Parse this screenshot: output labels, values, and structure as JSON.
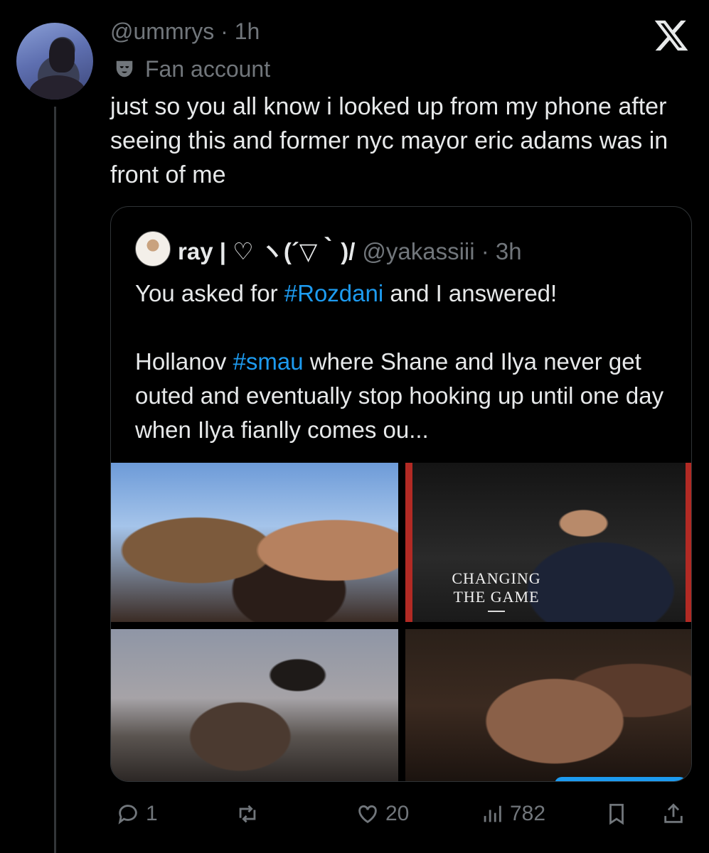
{
  "post": {
    "handle_time": "@ummrys · 1h",
    "label": "Fan account",
    "text": "just so you all know i looked up from my phone after seeing this and former nyc mayor eric adams was in front of me"
  },
  "quote": {
    "name": "ray | ♡ ヽ(´▽｀)/",
    "handle_time": "@yakassiii · 3h",
    "line1_pre": "You asked for ",
    "line1_tag": "#Rozdani",
    "line1_post": " and I answered!",
    "para_pre": "Hollanov ",
    "para_tag": "#smau",
    "para_post": " where Shane and Ilya never get outed and eventually stop hooking up until one day when Ilya fianlly comes ou...",
    "media": {
      "cover_text": "CHANGING THE GAME"
    }
  },
  "actions": {
    "replies": "1",
    "likes": "20",
    "views": "782"
  },
  "colors": {
    "background": "#000000",
    "text": "#e7e9ea",
    "muted": "#71767b",
    "link": "#1d9bf0",
    "border": "#2f3336"
  },
  "icons": [
    "x-logo-icon",
    "mask-icon",
    "reply-icon",
    "repost-icon",
    "like-icon",
    "views-icon",
    "bookmark-icon",
    "share-icon"
  ]
}
